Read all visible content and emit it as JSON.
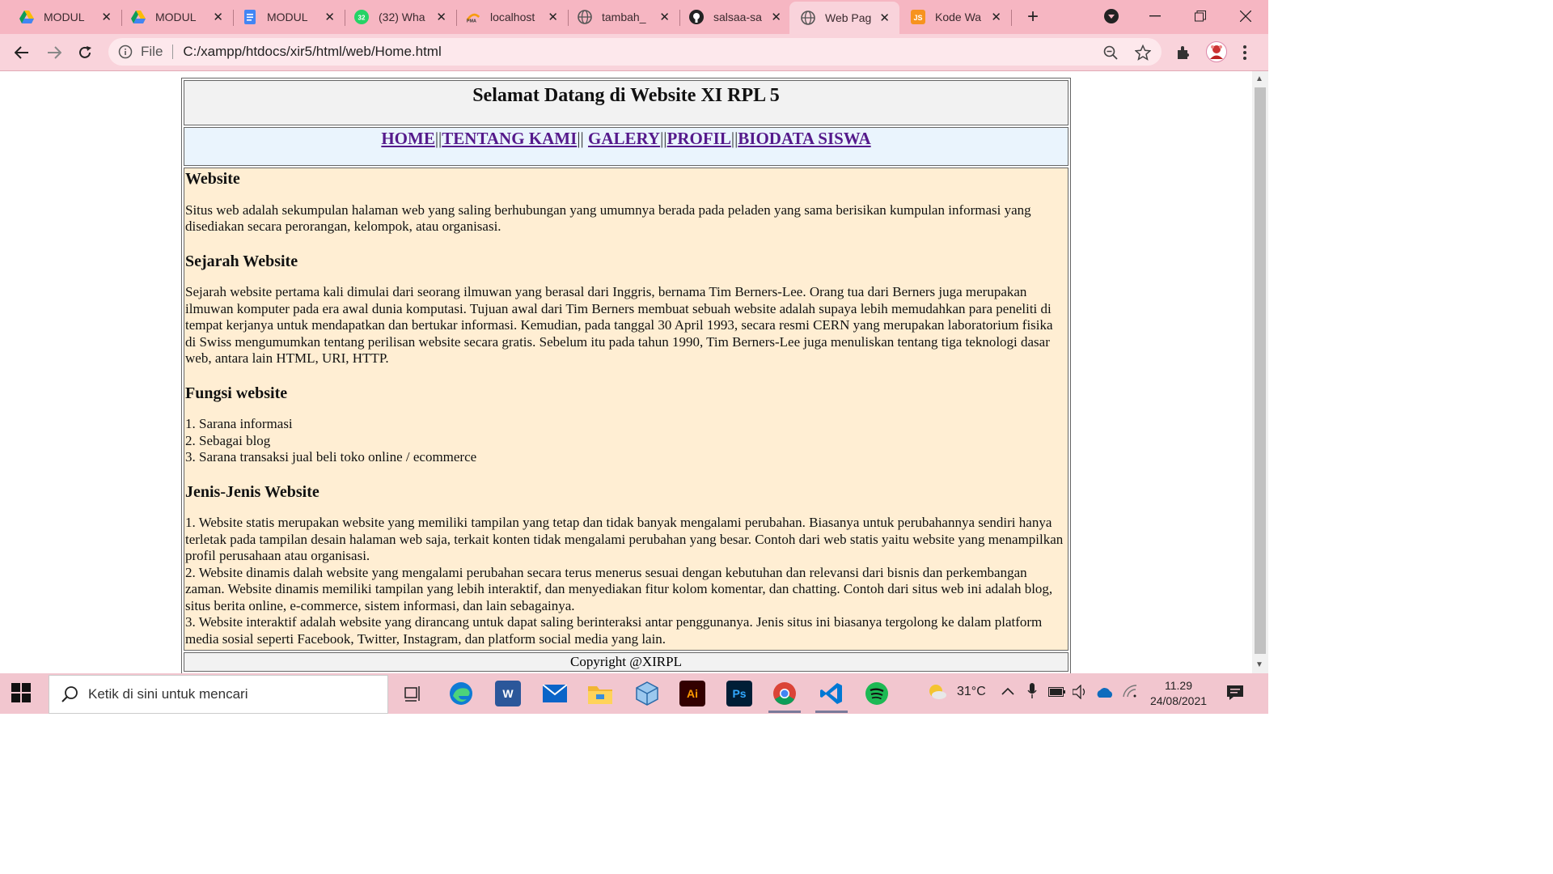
{
  "browser": {
    "tabs": [
      {
        "label": "MODUL",
        "icon": "google-drive-icon"
      },
      {
        "label": "MODUL",
        "icon": "google-drive-icon"
      },
      {
        "label": "MODUL",
        "icon": "google-docs-icon"
      },
      {
        "label": "(32) Wha",
        "icon": "whatsapp-icon"
      },
      {
        "label": "localhost",
        "icon": "phpmyadmin-icon"
      },
      {
        "label": "tambah_",
        "icon": "globe-icon"
      },
      {
        "label": "salsaa-sa",
        "icon": "github-icon"
      },
      {
        "label": "Web Pag",
        "icon": "globe-icon",
        "active": true
      },
      {
        "label": "Kode Wa",
        "icon": "js-icon"
      }
    ],
    "address": {
      "scheme_label": "File",
      "url": "C:/xampp/htdocs/xir5/html/web/Home.html"
    }
  },
  "page": {
    "title": "Selamat Datang di Website XI RPL 5",
    "nav": [
      "HOME",
      "TENTANG KAMI",
      "GALERY",
      "PROFIL",
      "BIODATA SISWA"
    ],
    "nav_sep": "||",
    "sections": [
      {
        "heading": "Website",
        "lines": [
          "Situs web adalah sekumpulan halaman web yang saling berhubungan yang umumnya berada pada peladen yang sama berisikan kumpulan informasi yang disediakan secara perorangan, kelompok, atau organisasi."
        ]
      },
      {
        "heading": "Sejarah Website",
        "lines": [
          "Sejarah website pertama kali dimulai dari seorang ilmuwan yang berasal dari Inggris, bernama Tim Berners-Lee. Orang tua dari Berners juga merupakan ilmuwan komputer pada era awal dunia komputasi. Tujuan awal dari Tim Berners membuat sebuah website adalah supaya lebih memudahkan para peneliti di tempat kerjanya untuk mendapatkan dan bertukar informasi. Kemudian, pada tanggal 30 April 1993, secara resmi CERN yang merupakan laboratorium fisika di Swiss mengumumkan tentang perilisan website secara gratis. Sebelum itu pada tahun 1990, Tim Berners-Lee juga menuliskan tentang tiga teknologi dasar web, antara lain HTML, URI, HTTP."
        ]
      },
      {
        "heading": "Fungsi website",
        "lines": [
          "1. Sarana informasi",
          "2. Sebagai blog",
          "3. Sarana transaksi jual beli toko online / ecommerce"
        ]
      },
      {
        "heading": "Jenis-Jenis Website",
        "lines": [
          "1. Website statis merupakan website yang memiliki tampilan yang tetap dan tidak banyak mengalami perubahan. Biasanya untuk perubahannya sendiri hanya terletak pada tampilan desain halaman web saja, terkait konten tidak mengalami perubahan yang besar. Contoh dari web statis yaitu website yang menampilkan profil perusahaan atau organisasi.",
          "2. Website dinamis dalah website yang mengalami perubahan secara terus menerus sesuai dengan kebutuhan dan relevansi dari bisnis dan perkembangan zaman. Website dinamis memiliki tampilan yang lebih interaktif, dan menyediakan fitur kolom komentar, dan chatting. Contoh dari situs web ini adalah blog, situs berita online, e-commerce, sistem informasi, dan lain sebagainya.",
          "3. Website interaktif adalah website yang dirancang untuk dapat saling berinteraksi antar penggunanya. Jenis situs ini biasanya tergolong ke dalam platform media sosial seperti Facebook, Twitter, Instagram, dan platform social media yang lain."
        ]
      }
    ],
    "footer": "Copyright @XIRPL"
  },
  "taskbar": {
    "search_placeholder": "Ketik di sini untuk mencari",
    "weather": "31°C",
    "time": "11.29",
    "date": "24/08/2021"
  },
  "colors": {
    "tabstrip": "#f6b6c2",
    "toolbar": "#f9d3db",
    "header_bg": "#f2f2f2",
    "nav_bg": "#eaf4fd",
    "content_bg": "#ffeed3",
    "link": "#551a8b"
  }
}
